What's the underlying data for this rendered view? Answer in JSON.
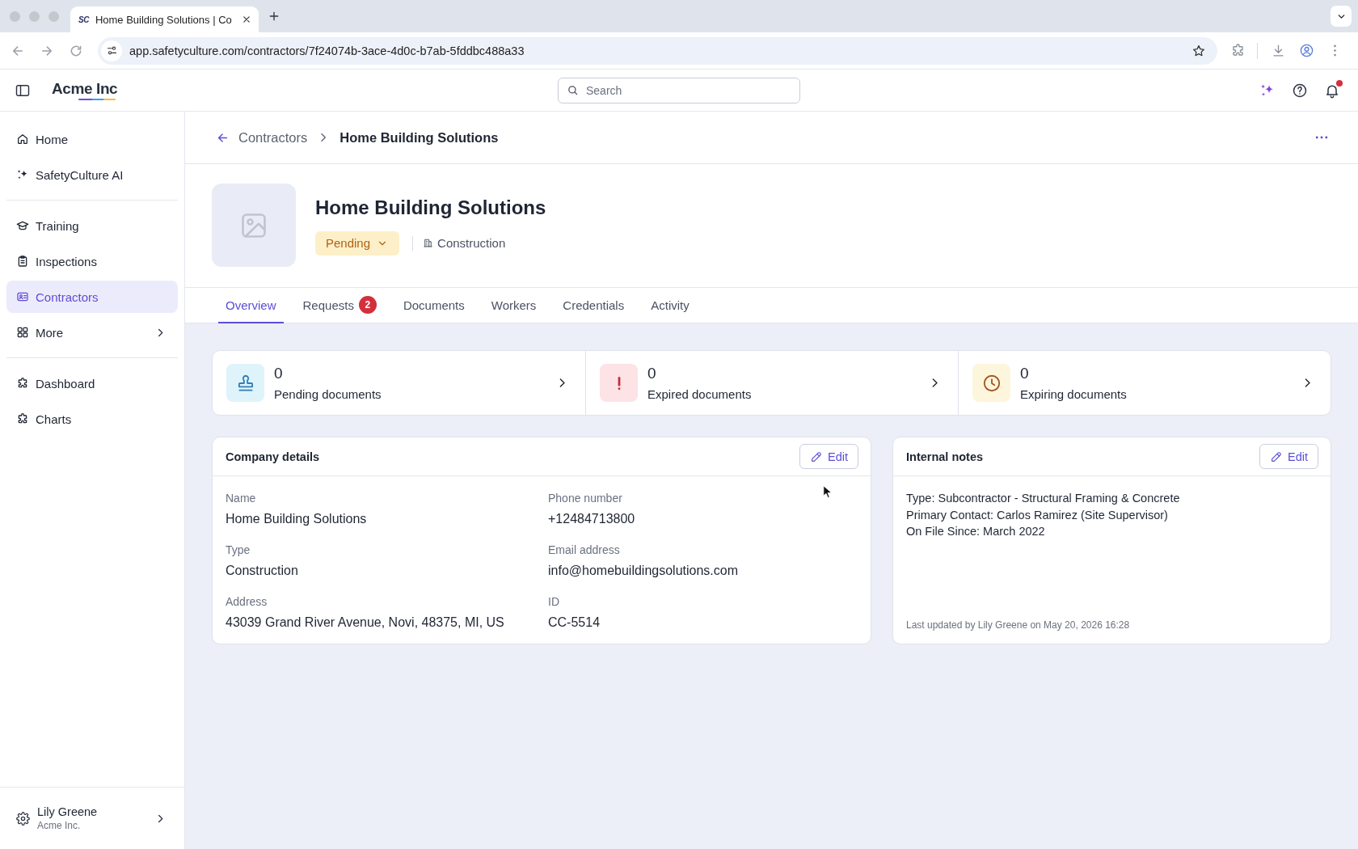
{
  "browser": {
    "tabs": [
      {
        "favicon": "SC",
        "title": "Home Building Solutions | Co",
        "selected": true
      }
    ],
    "address": "app.safetyculture.com/contractors/7f24074b-3ace-4d0c-b7ab-5fddbc488a33"
  },
  "app_header": {
    "logo": "Acme Inc",
    "search": {
      "placeholder": "Search"
    },
    "notifications": {
      "unread": true
    }
  },
  "sidebar": {
    "sections": [
      {
        "items": [
          {
            "label": "Home",
            "kind": "link",
            "selected": false
          },
          {
            "label": "SafetyCulture AI",
            "kind": "link",
            "selected": false
          }
        ]
      },
      {
        "items": [
          {
            "label": "Training",
            "kind": "link",
            "selected": false
          },
          {
            "label": "Inspections",
            "kind": "link",
            "selected": false
          },
          {
            "label": "Contractors",
            "kind": "link",
            "selected": true
          },
          {
            "label": "More",
            "kind": "submenu",
            "selected": false
          }
        ]
      },
      {
        "items": [
          {
            "label": "Dashboard",
            "kind": "link",
            "selected": false
          },
          {
            "label": "Charts",
            "kind": "link",
            "selected": false
          }
        ]
      }
    ],
    "user": {
      "name": "Lily Greene",
      "organization": "Acme Inc."
    }
  },
  "breadcrumb": {
    "parent": "Contractors",
    "current": "Home Building Solutions"
  },
  "contractor": {
    "name": "Home Building Solutions",
    "status": {
      "label": "Pending",
      "kind": "pending"
    },
    "type": "Construction"
  },
  "tabs": [
    {
      "label": "Overview",
      "selected": true
    },
    {
      "label": "Requests",
      "badge": "2",
      "selected": false
    },
    {
      "label": "Documents",
      "selected": false
    },
    {
      "label": "Workers",
      "selected": false
    },
    {
      "label": "Credentials",
      "selected": false
    },
    {
      "label": "Activity",
      "selected": false
    }
  ],
  "document_summary": [
    {
      "kind": "pending",
      "count": "0",
      "label": "Pending documents"
    },
    {
      "kind": "expired",
      "count": "0",
      "label": "Expired documents"
    },
    {
      "kind": "expiring",
      "count": "0",
      "label": "Expiring documents"
    }
  ],
  "company_details": {
    "title": "Company details",
    "edit_label": "Edit",
    "fields": [
      {
        "label": "Name",
        "value": "Home Building Solutions"
      },
      {
        "label": "Phone number",
        "value": "+12484713800"
      },
      {
        "label": "Type",
        "value": "Construction"
      },
      {
        "label": "Email address",
        "value": "info@homebuildingsolutions.com"
      },
      {
        "label": "Address",
        "value": "43039 Grand River Avenue, Novi, 48375, MI, US"
      },
      {
        "label": "ID",
        "value": "CC-5514"
      }
    ]
  },
  "internal_notes": {
    "title": "Internal notes",
    "edit_label": "Edit",
    "lines": [
      "Type: Subcontractor - Structural Framing & Concrete",
      "Primary Contact: Carlos Ramirez (Site Supervisor)",
      "On File Since: March 2022"
    ],
    "last_updated": "Last updated by Lily Greene on May 20, 2026 16:28"
  }
}
